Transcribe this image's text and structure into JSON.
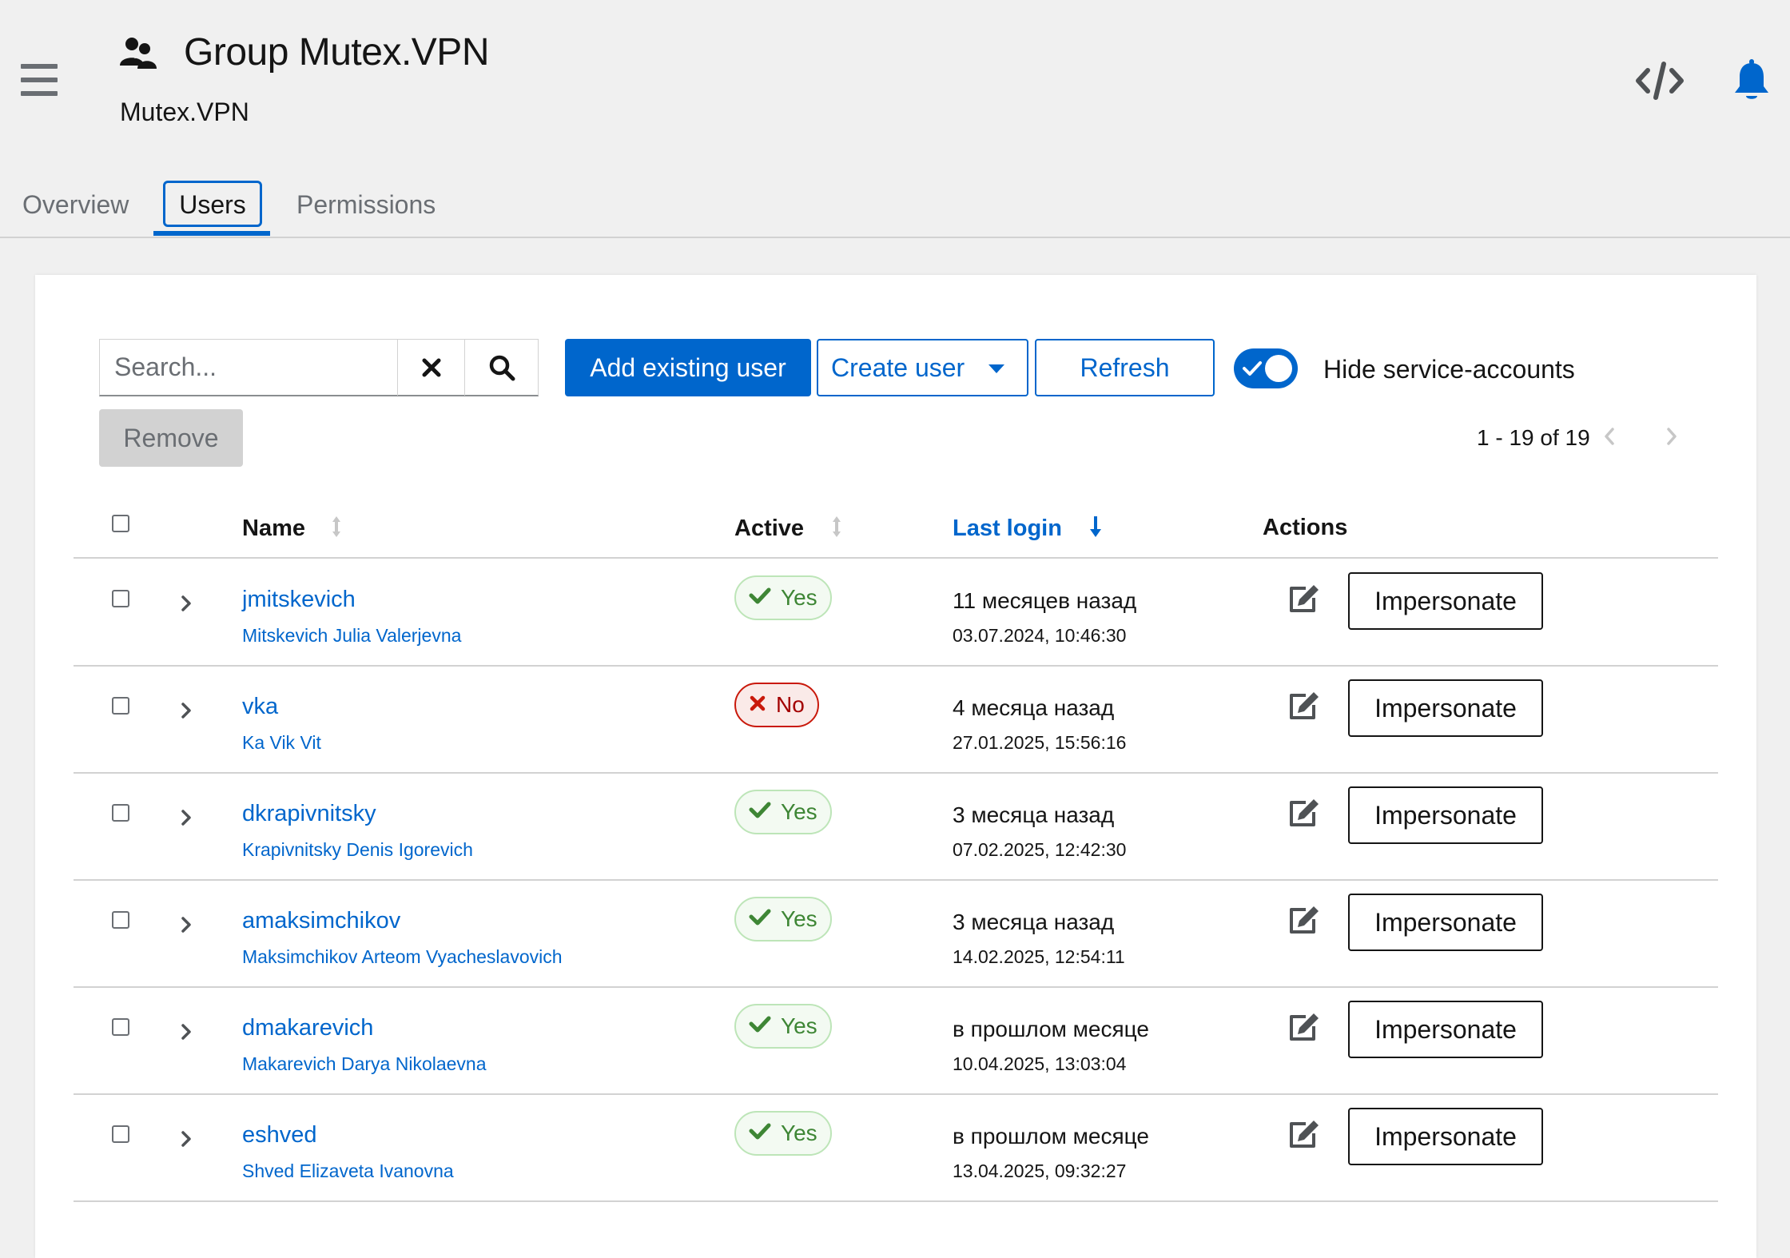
{
  "header": {
    "title": "Group Mutex.VPN",
    "subtitle": "Mutex.VPN"
  },
  "tabs": [
    {
      "label": "Overview"
    },
    {
      "label": "Users"
    },
    {
      "label": "Permissions"
    }
  ],
  "toolbar": {
    "search_placeholder": "Search...",
    "add_existing_label": "Add existing user",
    "create_user_label": "Create user",
    "refresh_label": "Refresh",
    "hide_service_accounts_label": "Hide service-accounts",
    "hide_service_accounts_on": true,
    "remove_label": "Remove",
    "pagination": "1 - 19 of 19"
  },
  "table": {
    "columns": {
      "name": "Name",
      "active": "Active",
      "last_login": "Last login",
      "actions": "Actions"
    },
    "rows": [
      {
        "username": "jmitskevich",
        "full_name": "Mitskevich Julia Valerjevna",
        "active": "Yes",
        "relative": "11 месяцев назад",
        "date": "03.07.2024, 10:46:30",
        "action": "Impersonate"
      },
      {
        "username": "vka",
        "full_name": "Ka Vik Vit",
        "active": "No",
        "relative": "4 месяца назад",
        "date": "27.01.2025, 15:56:16",
        "action": "Impersonate"
      },
      {
        "username": "dkrapivnitsky",
        "full_name": "Krapivnitsky Denis Igorevich",
        "active": "Yes",
        "relative": "3 месяца назад",
        "date": "07.02.2025, 12:42:30",
        "action": "Impersonate"
      },
      {
        "username": "amaksimchikov",
        "full_name": "Maksimchikov Arteom Vyacheslavovich",
        "active": "Yes",
        "relative": "3 месяца назад",
        "date": "14.02.2025, 12:54:11",
        "action": "Impersonate"
      },
      {
        "username": "dmakarevich",
        "full_name": "Makarevich Darya Nikolaevna",
        "active": "Yes",
        "relative": "в прошлом месяце",
        "date": "10.04.2025, 13:03:04",
        "action": "Impersonate"
      },
      {
        "username": "eshved",
        "full_name": "Shved Elizaveta Ivanovna",
        "active": "Yes",
        "relative": "в прошлом месяце",
        "date": "13.04.2025, 09:32:27",
        "action": "Impersonate"
      }
    ]
  },
  "colors": {
    "accent": "#0066cc",
    "success": "#3e8635",
    "danger": "#c9190b",
    "background": "#f0f0f0"
  },
  "icons": {
    "menu": "hamburger-icon",
    "group": "users-group-icon",
    "code": "code-icon",
    "notifications": "bell-icon",
    "clear": "close-icon",
    "search": "search-icon",
    "sort": "sort-icon",
    "sort_desc": "arrow-down-icon",
    "expand": "chevron-right-icon",
    "edit": "edit-icon",
    "check": "check-icon",
    "no": "times-icon"
  }
}
